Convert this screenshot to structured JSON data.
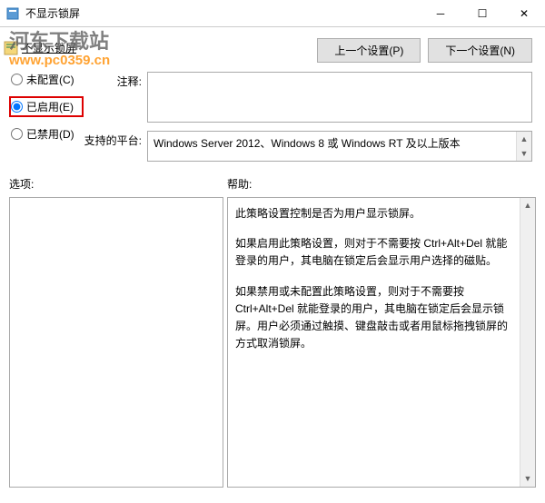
{
  "window": {
    "title": "不显示锁屏"
  },
  "watermark": {
    "line1": "河东下载站",
    "line2": "www.pc0359.cn"
  },
  "header": {
    "link_text": "不显示锁屏",
    "btn_prev": "上一个设置(P)",
    "btn_next": "下一个设置(N)"
  },
  "radios": {
    "not_configured": "未配置(C)",
    "enabled": "已启用(E)",
    "disabled": "已禁用(D)",
    "selected": "enabled"
  },
  "labels": {
    "comment": "注释:",
    "supported": "支持的平台:",
    "options": "选项:",
    "help": "帮助:"
  },
  "supported_text": "Windows Server 2012、Windows 8 或 Windows RT 及以上版本",
  "help": {
    "p1": "此策略设置控制是否为用户显示锁屏。",
    "p2": "如果启用此策略设置，则对于不需要按 Ctrl+Alt+Del 就能登录的用户，其电脑在锁定后会显示用户选择的磁贴。",
    "p3": "如果禁用或未配置此策略设置，则对于不需要按 Ctrl+Alt+Del 就能登录的用户，其电脑在锁定后会显示锁屏。用户必须通过触摸、键盘敲击或者用鼠标拖拽锁屏的方式取消锁屏。"
  }
}
